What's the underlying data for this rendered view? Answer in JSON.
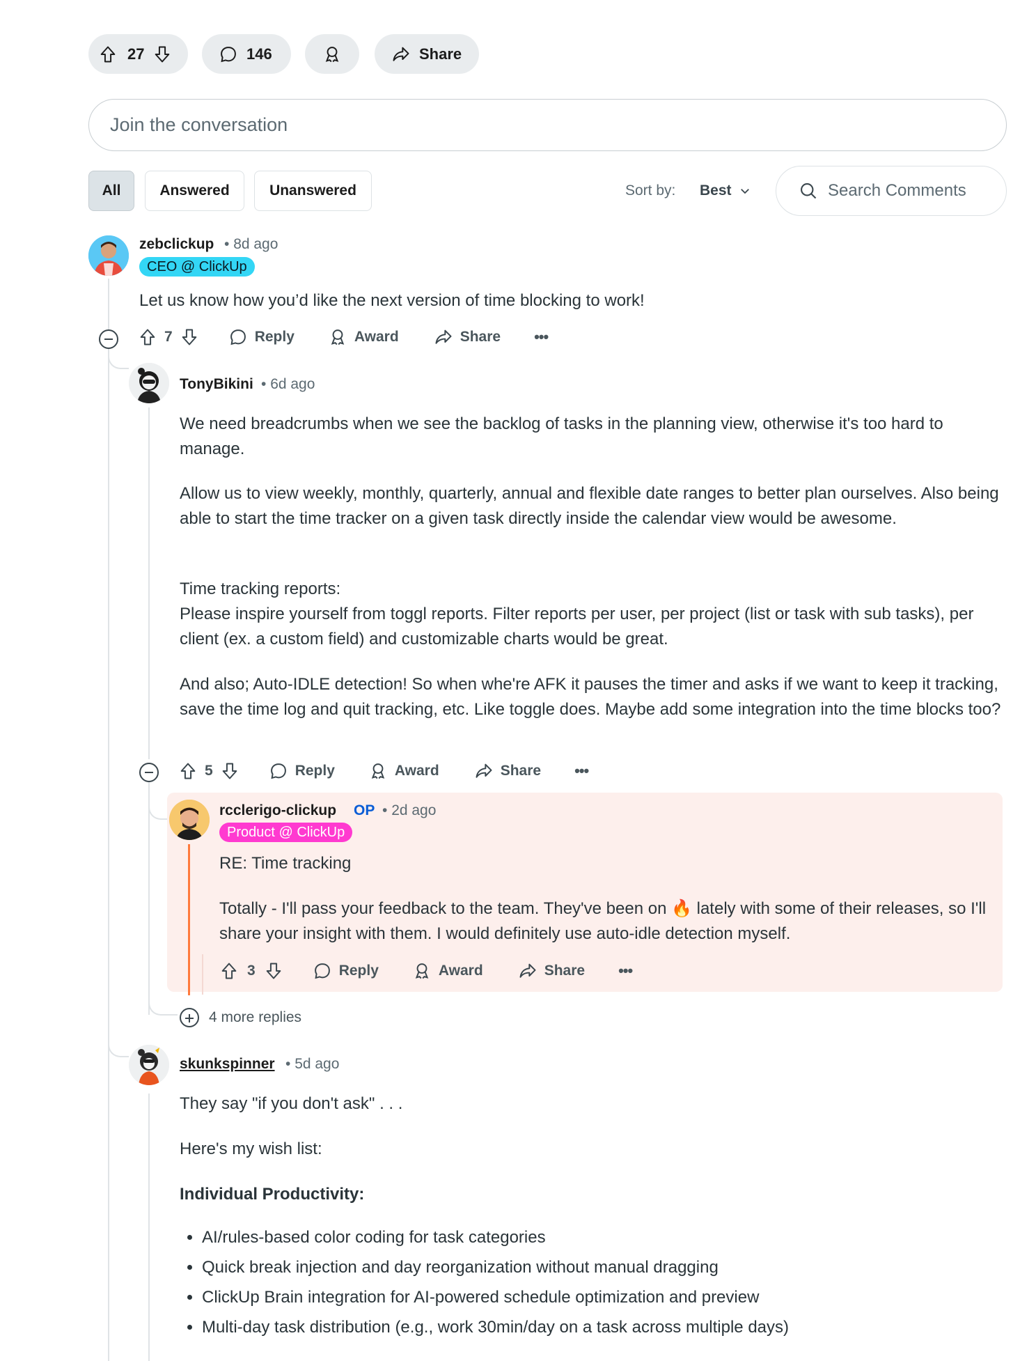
{
  "post_actions": {
    "vote_count": "27",
    "comment_count": "146",
    "share_label": "Share"
  },
  "composer": {
    "placeholder": "Join the conversation"
  },
  "filters": {
    "all": "All",
    "answered": "Answered",
    "unanswered": "Unanswered"
  },
  "sort": {
    "label": "Sort by:",
    "value": "Best"
  },
  "search": {
    "placeholder": "Search Comments"
  },
  "comments": [
    {
      "username": "zebclickup",
      "time": "8d ago",
      "flair": "CEO @ ClickUp",
      "flair_color": "#33d6f5",
      "body": "Let us know how you’d like the next version of time blocking to work!",
      "votes": "7",
      "reply": "Reply",
      "award": "Award",
      "share": "Share"
    },
    {
      "username": "TonyBikini",
      "time": "6d ago",
      "paragraphs": [
        "We need breadcrumbs when we see the backlog of tasks in the planning view, otherwise it's too hard to manage.",
        "Allow us to view weekly, monthly, quarterly, annual and flexible date ranges to better plan ourselves. Also being able to start the time tracker on a given task directly inside the calendar view would be awesome.",
        "Time tracking reports:",
        "Please inspire yourself from toggl reports. Filter reports per user, per project (list or task with sub tasks), per client (ex. a custom field) and customizable charts would be great.",
        "And also; Auto-IDLE detection! So when whe're AFK it pauses the timer and asks if we want to keep it tracking, save the time log and quit tracking, etc. Like toggle does. Maybe add some integration into the time blocks too?"
      ],
      "votes": "5",
      "reply": "Reply",
      "award": "Award",
      "share": "Share"
    },
    {
      "username": "rcclerigo-clickup",
      "op_badge": "OP",
      "time": "2d ago",
      "flair": "Product @ ClickUp",
      "flair_color": "#ff3ad0",
      "paragraphs": [
        "RE: Time tracking",
        "Totally - I'll pass your feedback to the team. They've been on 🔥 lately with some of their releases, so I'll share your insight with them. I would definitely use auto-idle detection myself."
      ],
      "votes": "3",
      "reply": "Reply",
      "award": "Award",
      "share": "Share"
    },
    {
      "username": "skunkspinner",
      "time": "5d ago",
      "paragraphs": [
        "They say \"if you don't ask\" . . .",
        "Here's my wish list:"
      ],
      "heading": "Individual Productivity:",
      "wish_list": [
        "AI/rules-based color coding for task categories",
        "Quick break injection and day reorganization without manual dragging",
        "ClickUp Brain integration for AI-powered schedule optimization and preview",
        "Multi-day task distribution (e.g., work 30min/day on a task across multiple days)"
      ]
    }
  ],
  "more_replies": "4 more replies",
  "colors": {
    "highlight_bg": "#fdefec",
    "op_blue": "#0a5dd6",
    "accent_orange": "#ff6a00"
  }
}
